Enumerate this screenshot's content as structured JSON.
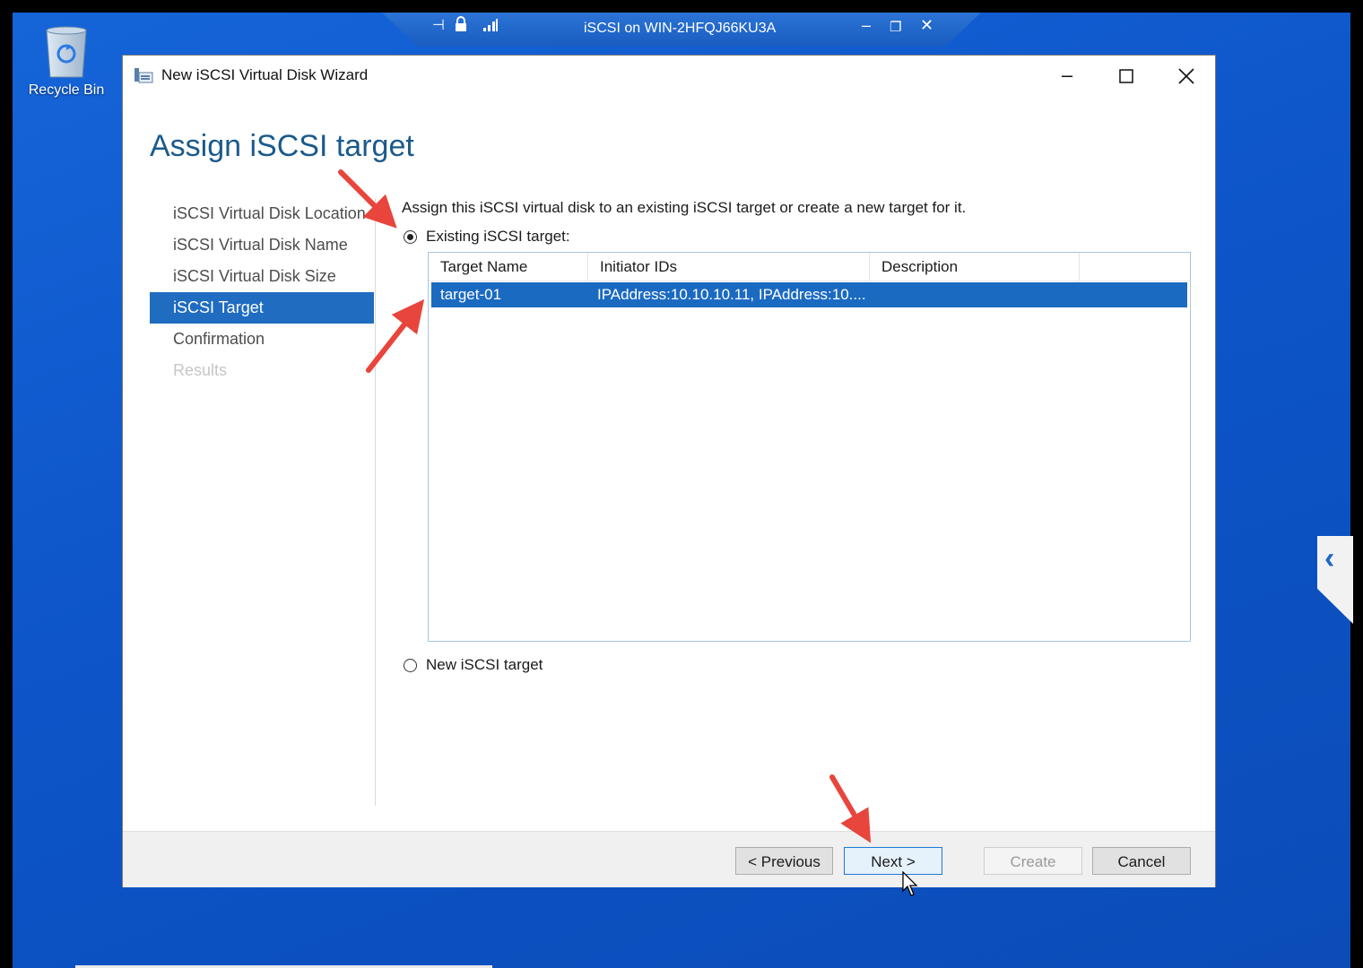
{
  "desktop": {
    "recycle_bin_label": "Recycle Bin",
    "accent_color": "#1565d8"
  },
  "rdp_bar": {
    "title": "iSCSI on WIN-2HFQJ66KU3A",
    "icons": [
      "pin-icon",
      "lock-icon",
      "signal-icon",
      "minimize-icon",
      "restore-icon",
      "close-icon"
    ]
  },
  "wizard": {
    "window_title": "New iSCSI Virtual Disk Wizard",
    "page_heading": "Assign iSCSI target",
    "nav_items": [
      {
        "label": "iSCSI Virtual Disk Location",
        "state": "normal"
      },
      {
        "label": "iSCSI Virtual Disk Name",
        "state": "normal"
      },
      {
        "label": "iSCSI Virtual Disk Size",
        "state": "normal"
      },
      {
        "label": "iSCSI Target",
        "state": "active"
      },
      {
        "label": "Confirmation",
        "state": "normal"
      },
      {
        "label": "Results",
        "state": "disabled"
      }
    ],
    "description": "Assign this iSCSI virtual disk to an existing iSCSI target or create a new target for it.",
    "existing_target_label": "Existing iSCSI target:",
    "new_target_label": "New iSCSI target",
    "table": {
      "columns": [
        "Target Name",
        "Initiator IDs",
        "Description"
      ],
      "rows": [
        {
          "target_name": "target-01",
          "initiator_ids": "IPAddress:10.10.10.11, IPAddress:10....",
          "description": "",
          "selected": true
        }
      ]
    },
    "buttons": {
      "previous": "< Previous",
      "next": "Next >",
      "create": "Create",
      "cancel": "Cancel"
    },
    "selection_color": "#1b6ac2",
    "heading_color": "#1a5a8c"
  }
}
